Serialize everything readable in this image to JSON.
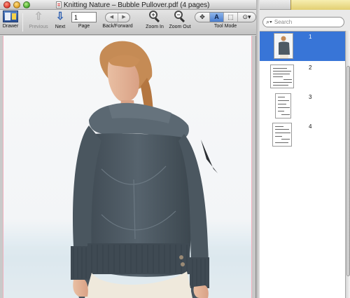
{
  "window": {
    "title": "Knitting Nature – Bubble Pullover.pdf (4 pages)"
  },
  "toolbar": {
    "drawer_label": "Drawer",
    "previous_label": "Previous",
    "next_label": "Next",
    "page_label": "Page",
    "page_value": "1",
    "back_forward_label": "Back/Forward",
    "zoom_in_label": "Zoom In",
    "zoom_out_label": "Zoom Out",
    "tool_mode_label": "Tool Mode",
    "tool_modes": [
      "move",
      "text",
      "select",
      "annotate"
    ],
    "active_tool_mode": "text",
    "text_tool_glyph": "A"
  },
  "drawer": {
    "search_placeholder": "Search",
    "thumbnails": [
      {
        "page": "1",
        "selected": true
      },
      {
        "page": "2",
        "selected": false
      },
      {
        "page": "3",
        "selected": false
      },
      {
        "page": "4",
        "selected": false
      }
    ]
  },
  "colors": {
    "selection": "#3875d7",
    "sweater": "#4d5a63",
    "hair": "#c58b55",
    "page_border": "#f2b0bd"
  },
  "icons": [
    "drawer-icon",
    "arrow-up-icon",
    "arrow-down-icon",
    "arrow-left-icon",
    "arrow-right-icon",
    "zoom-in-icon",
    "zoom-out-icon",
    "move-tool-icon",
    "text-tool-icon",
    "select-tool-icon",
    "annotate-tool-icon",
    "search-icon"
  ]
}
